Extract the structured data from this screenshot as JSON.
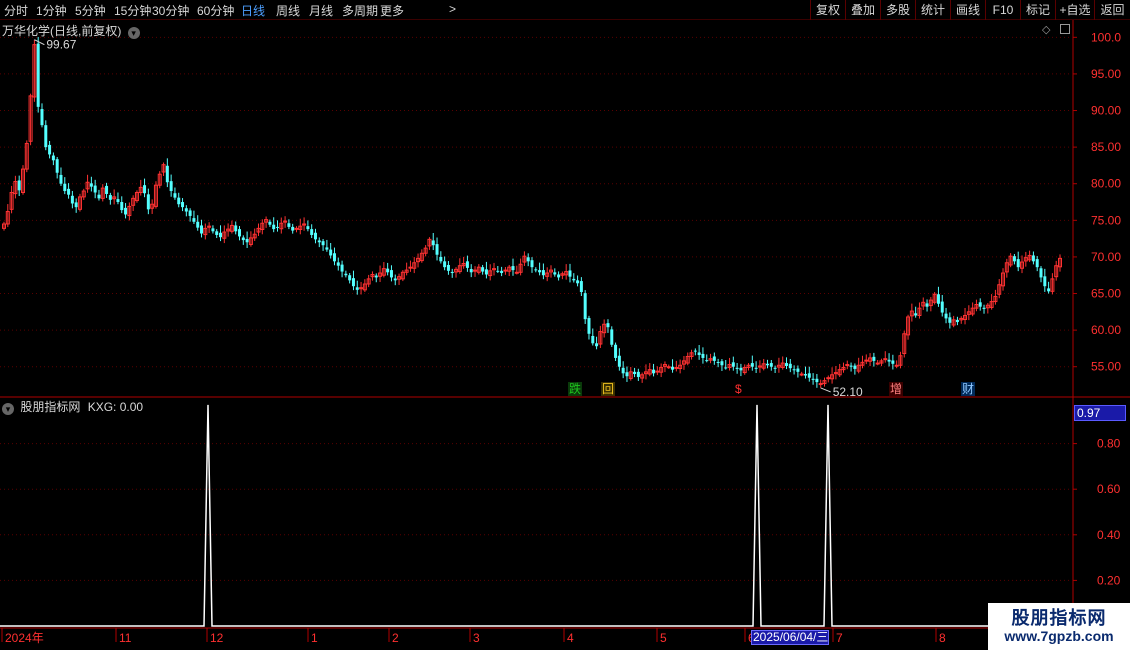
{
  "toolbar": {
    "timeframes": [
      {
        "label": "分时",
        "active": false
      },
      {
        "label": "1分钟",
        "active": false
      },
      {
        "label": "5分钟",
        "active": false
      },
      {
        "label": "15分钟",
        "active": false
      },
      {
        "label": "30分钟",
        "active": false
      },
      {
        "label": "60分钟",
        "active": false
      },
      {
        "label": "日线",
        "active": true
      },
      {
        "label": "周线",
        "active": false
      },
      {
        "label": "月线",
        "active": false
      },
      {
        "label": "多周期",
        "active": false
      },
      {
        "label": "更多",
        "active": false
      }
    ],
    "more_arrow": ">",
    "right_buttons": [
      "复权",
      "叠加",
      "多股",
      "统计",
      "画线",
      "F10",
      "标记",
      "+自选",
      "返回"
    ]
  },
  "main_panel": {
    "title": "万华化学(日线,前复权)",
    "y_ticks": [
      "100.0",
      "95.00",
      "90.00",
      "85.00",
      "80.00",
      "75.00",
      "70.00",
      "65.00",
      "60.00",
      "55.00"
    ],
    "high_marker": "99.67",
    "low_marker": "52.10",
    "signal_tags": [
      {
        "text": "跌",
        "color": "#1ec31e",
        "bg": "#0a3a0a"
      },
      {
        "text": "回",
        "color": "#f0c020",
        "bg": "#3a3000"
      },
      {
        "text": "$",
        "color": "#ff3030",
        "bg": "#000000"
      },
      {
        "text": "增",
        "color": "#ff8080",
        "bg": "#3a0000"
      },
      {
        "text": "财",
        "color": "#8fc8ff",
        "bg": "#002a5a"
      }
    ]
  },
  "indicator_panel": {
    "title": "股朋指标网",
    "indicator": "KXG: 0.00",
    "value_box": "0.97",
    "y_ticks": [
      "0.80",
      "0.60",
      "0.40",
      "0.20"
    ]
  },
  "x_axis": {
    "labels": [
      "2024年",
      "11",
      "12",
      "1",
      "2",
      "3",
      "4",
      "5",
      "6",
      "7",
      "8"
    ],
    "cursor_date": "2025/06/04/三"
  },
  "watermark": {
    "line1": "股朋指标网",
    "line2": "www.7gpzb.com"
  },
  "colors": {
    "up": "#ff3232",
    "down": "#54ffff",
    "axis": "#b00000",
    "text": "#d8d8d8",
    "active": "#4ea0ff"
  },
  "chart_data": {
    "type": "candlestick",
    "ylim": [
      51,
      101
    ],
    "y_ticks": [
      55,
      60,
      65,
      70,
      75,
      80,
      85,
      90,
      95,
      100
    ],
    "closes": [
      74.5,
      76.2,
      78.8,
      80.3,
      79.1,
      82.0,
      85.5,
      92.0,
      99.0,
      90.5,
      88.0,
      85.0,
      84.0,
      83.2,
      81.5,
      80.0,
      79.0,
      78.5,
      77.3,
      76.8,
      78.2,
      79.0,
      80.2,
      79.6,
      78.8,
      78.0,
      79.4,
      78.6,
      77.8,
      78.2,
      77.5,
      76.4,
      75.8,
      76.9,
      78.0,
      78.8,
      79.5,
      78.7,
      76.5,
      77.2,
      79.8,
      81.3,
      82.6,
      80.2,
      79.0,
      78.1,
      77.2,
      76.8,
      76.2,
      75.6,
      74.8,
      74.0,
      73.2,
      73.9,
      74.2,
      73.5,
      73.0,
      72.7,
      73.4,
      73.8,
      74.3,
      73.5,
      72.8,
      72.3,
      72.0,
      72.6,
      73.1,
      73.9,
      74.6,
      75.1,
      74.4,
      73.8,
      74.0,
      74.6,
      74.9,
      74.1,
      73.6,
      73.9,
      74.2,
      74.5,
      73.8,
      73.0,
      72.4,
      72.0,
      71.6,
      71.0,
      70.2,
      69.4,
      68.8,
      68.0,
      67.5,
      66.8,
      66.0,
      65.5,
      65.8,
      66.3,
      67.0,
      67.6,
      67.2,
      67.8,
      68.4,
      67.9,
      67.2,
      66.8,
      67.3,
      67.9,
      68.2,
      68.6,
      69.2,
      69.8,
      70.5,
      71.2,
      72.4,
      71.6,
      70.3,
      69.4,
      68.6,
      68.1,
      67.8,
      68.3,
      68.8,
      69.1,
      68.5,
      67.9,
      68.2,
      68.6,
      68.0,
      67.6,
      68.1,
      68.4,
      68.1,
      67.8,
      68.2,
      68.6,
      68.2,
      67.9,
      69.0,
      70.1,
      69.4,
      68.6,
      68.2,
      67.9,
      67.5,
      67.8,
      68.2,
      67.6,
      67.2,
      67.7,
      68.0,
      67.3,
      66.8,
      66.4,
      65.2,
      61.5,
      59.5,
      58.2,
      57.8,
      59.8,
      60.8,
      60.4,
      58.0,
      56.2,
      55.0,
      54.1,
      53.7,
      54.3,
      54.0,
      53.6,
      53.9,
      54.3,
      54.6,
      54.1,
      54.4,
      54.9,
      55.3,
      55.0,
      54.6,
      54.9,
      55.2,
      55.8,
      56.4,
      56.9,
      57.1,
      56.6,
      56.2,
      55.9,
      56.1,
      55.8,
      55.6,
      55.2,
      54.9,
      55.3,
      55.0,
      54.7,
      54.5,
      54.9,
      55.2,
      55.0,
      54.8,
      55.1,
      55.4,
      55.2,
      55.0,
      54.8,
      55.2,
      55.5,
      55.1,
      54.8,
      54.6,
      54.3,
      54.0,
      53.8,
      53.5,
      53.2,
      52.9,
      52.7,
      53.1,
      53.5,
      53.9,
      54.2,
      54.6,
      54.9,
      55.3,
      55.0,
      54.7,
      55.2,
      55.6,
      55.9,
      56.2,
      55.8,
      55.5,
      55.8,
      56.1,
      55.7,
      55.4,
      55.2,
      56.5,
      59.5,
      61.8,
      62.6,
      62.0,
      63.0,
      63.8,
      63.2,
      64.1,
      64.9,
      63.6,
      62.4,
      61.6,
      61.0,
      61.4,
      61.1,
      61.6,
      62.0,
      62.5,
      63.0,
      63.5,
      63.2,
      62.9,
      63.4,
      63.9,
      64.6,
      66.2,
      67.8,
      69.2,
      70.1,
      69.4,
      68.6,
      69.3,
      69.9,
      70.2,
      69.4,
      68.6,
      67.2,
      66.0,
      65.3,
      67.0,
      68.8,
      69.8
    ]
  }
}
